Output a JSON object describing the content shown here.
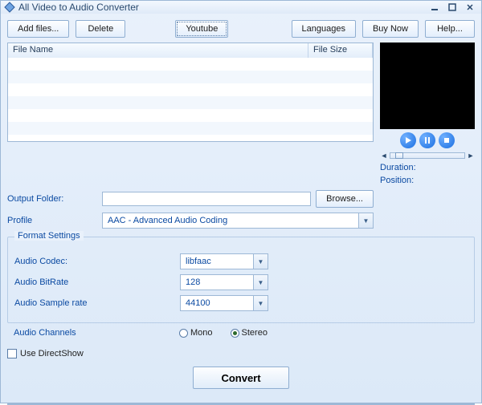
{
  "window": {
    "title": "All Video to Audio Converter"
  },
  "toolbar": {
    "add_files": "Add files...",
    "delete": "Delete",
    "youtube": "Youtube",
    "languages": "Languages",
    "buy_now": "Buy Now",
    "help": "Help..."
  },
  "list": {
    "col_name": "File Name",
    "col_size": "File Size"
  },
  "player": {
    "duration_label": "Duration:",
    "position_label": "Position:"
  },
  "output": {
    "label": "Output Folder:",
    "value": "",
    "browse": "Browse..."
  },
  "profile": {
    "label": "Profile",
    "value": "AAC - Advanced Audio Coding"
  },
  "format": {
    "legend": "Format Settings",
    "codec_label": "Audio Codec:",
    "codec_value": "libfaac",
    "bitrate_label": "Audio BitRate",
    "bitrate_value": "128",
    "sample_label": "Audio Sample rate",
    "sample_value": "44100"
  },
  "channels": {
    "label": "Audio Channels",
    "mono": "Mono",
    "stereo": "Stereo",
    "selected": "stereo"
  },
  "directshow": {
    "label": "Use DirectShow",
    "checked": false
  },
  "convert": {
    "label": "Convert"
  }
}
